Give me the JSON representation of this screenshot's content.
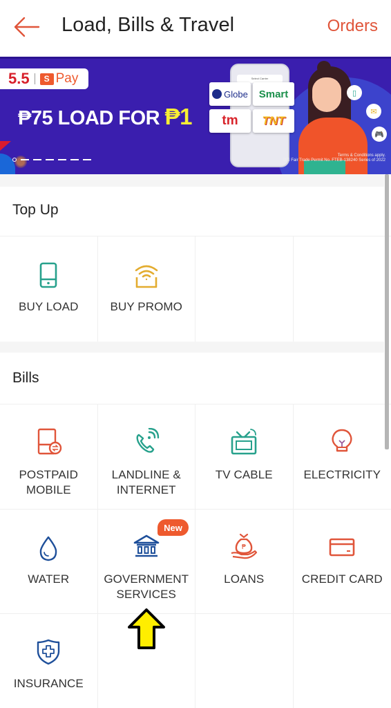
{
  "header": {
    "title": "Load, Bills & Travel",
    "orders_label": "Orders",
    "back_icon": "arrow-left-icon"
  },
  "banner": {
    "promo_number": "5.5",
    "spay_glyph": "S",
    "pay_text": "Pay",
    "headline_prefix": "₱75 LOAD FOR ",
    "headline_highlight": "₱1",
    "phone_header": "Select Carrier",
    "carriers": [
      "Globe",
      "Smart",
      "tm",
      "TNT"
    ],
    "terms_line1": "Terms & Conditions apply.",
    "terms_line2": "DTI Fair Trade Permit No. FTEB-138240 Series of 2022",
    "slide_count": 7,
    "active_slide": 1,
    "colors": {
      "background": "#3a1eae",
      "highlight": "#f7ee34",
      "accent": "#ee5a2e"
    }
  },
  "topup": {
    "title": "Top Up",
    "items": [
      {
        "label": "BUY LOAD",
        "icon": "mobile-phone-icon",
        "color": "#27a18c"
      },
      {
        "label": "BUY PROMO",
        "icon": "wifi-box-icon",
        "color": "#e3ac2f"
      }
    ]
  },
  "bills": {
    "title": "Bills",
    "items": [
      {
        "label_line1": "POSTPAID",
        "label_line2": "MOBILE",
        "icon": "postpaid-mobile-icon",
        "color": "#e0553a"
      },
      {
        "label_line1": "LANDLINE &",
        "label_line2": "INTERNET",
        "icon": "phone-signal-icon",
        "color": "#27a18c"
      },
      {
        "label_line1": "TV CABLE",
        "label_line2": "",
        "icon": "tv-icon",
        "color": "#27a18c"
      },
      {
        "label_line1": "ELECTRICITY",
        "label_line2": "",
        "icon": "lightbulb-icon",
        "color": "#e0553a"
      },
      {
        "label_line1": "WATER",
        "label_line2": "",
        "icon": "water-drop-icon",
        "color": "#1e4f9a"
      },
      {
        "label_line1": "GOVERNMENT",
        "label_line2": "SERVICES",
        "icon": "government-building-icon",
        "color": "#1e4f9a",
        "badge": "New"
      },
      {
        "label_line1": "LOANS",
        "label_line2": "",
        "icon": "money-bag-hand-icon",
        "color": "#e0553a"
      },
      {
        "label_line1": "CREDIT CARD",
        "label_line2": "",
        "icon": "credit-card-icon",
        "color": "#e0553a"
      },
      {
        "label_line1": "INSURANCE",
        "label_line2": "",
        "icon": "shield-plus-icon",
        "color": "#1e4f9a"
      }
    ]
  },
  "annotation": {
    "icon": "yellow-up-arrow-icon",
    "color": "#ffee00"
  },
  "colors": {
    "accent": "#e0553a",
    "text": "#222222"
  }
}
